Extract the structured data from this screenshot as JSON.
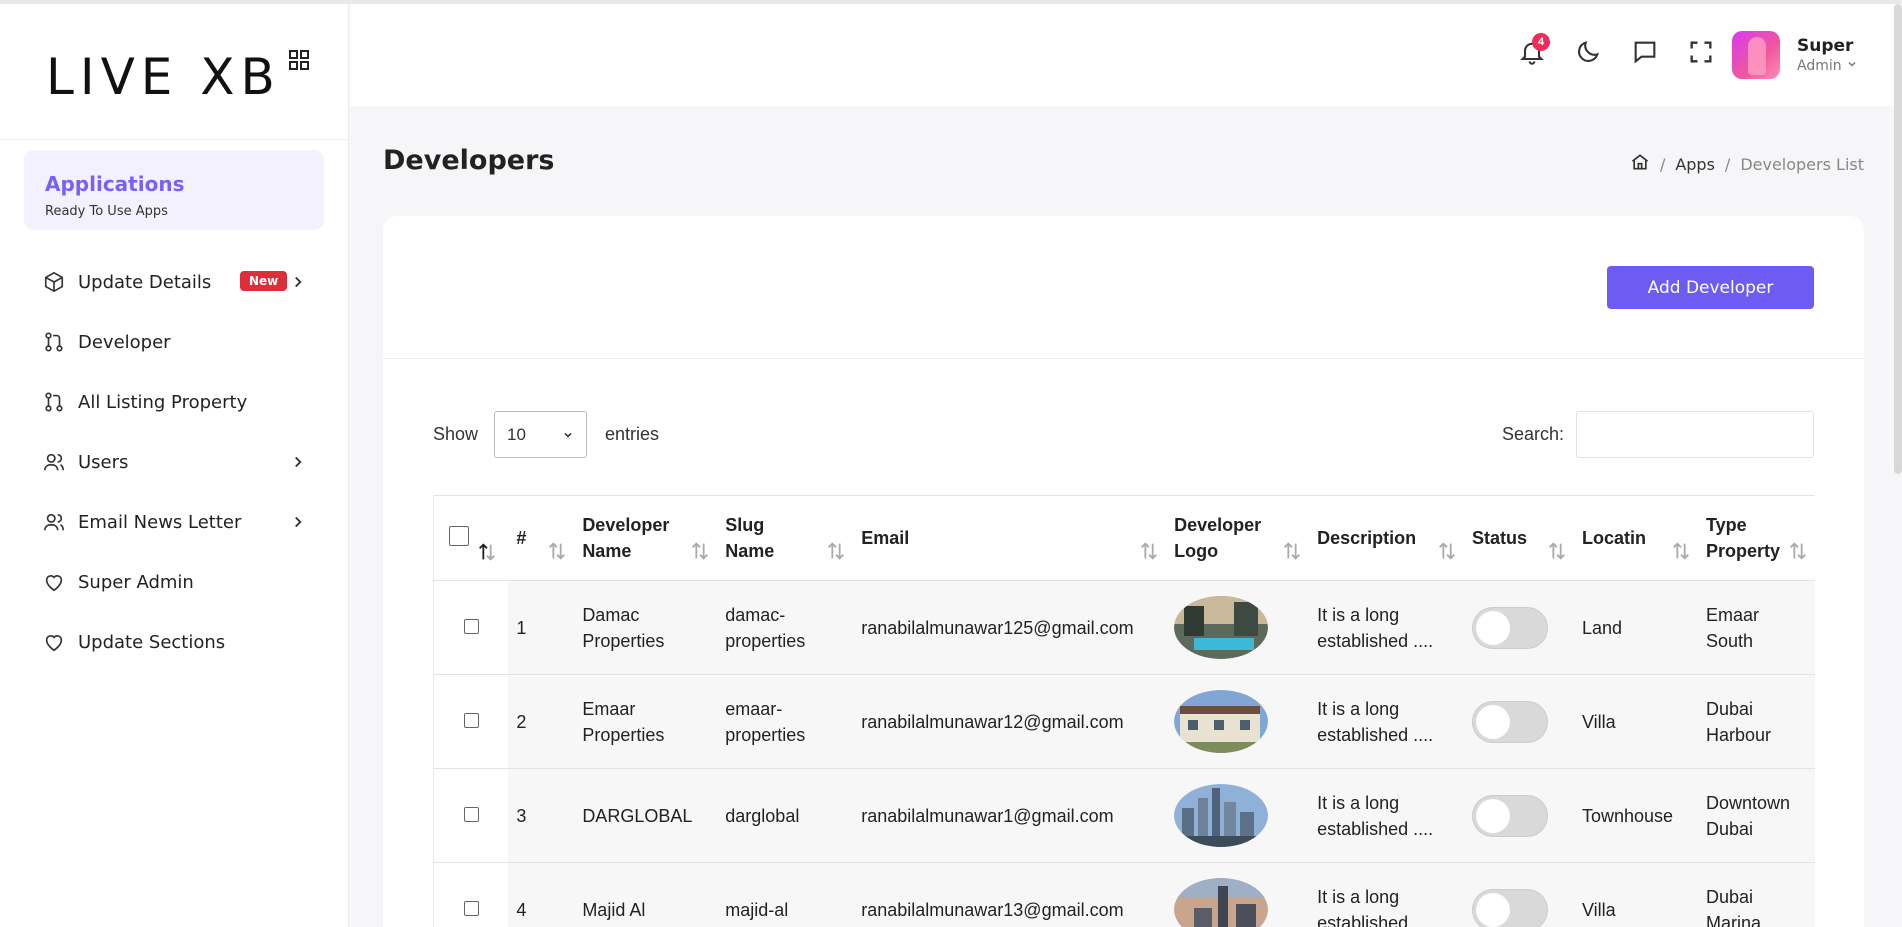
{
  "brand": {
    "logo_text": "LIVE XB"
  },
  "sidebar": {
    "app_card": {
      "title": "Applications",
      "subtitle": "Ready To Use Apps"
    },
    "items": [
      {
        "label": "Update Details",
        "badge": "New",
        "icon": "cube-icon",
        "has_chevron": true
      },
      {
        "label": "Developer",
        "icon": "git-pull-icon",
        "has_chevron": false
      },
      {
        "label": "All Listing Property",
        "icon": "git-pull-icon",
        "has_chevron": false
      },
      {
        "label": "Users",
        "icon": "users-icon",
        "has_chevron": true
      },
      {
        "label": "Email News Letter",
        "icon": "users-icon",
        "has_chevron": true
      },
      {
        "label": "Super Admin",
        "icon": "heart-icon",
        "has_chevron": false
      },
      {
        "label": "Update Sections",
        "icon": "heart-icon",
        "has_chevron": false
      }
    ]
  },
  "header": {
    "notification_count": "4",
    "user_name": "Super",
    "user_role": "Admin"
  },
  "page": {
    "title": "Developers",
    "breadcrumb": {
      "level1": "Apps",
      "level2": "Developers List"
    }
  },
  "toolbar": {
    "add_label": "Add Developer",
    "show_label": "Show",
    "entries_value": "10",
    "entries_label": "entries",
    "search_label": "Search:",
    "search_value": ""
  },
  "table": {
    "columns": {
      "num": "#",
      "name": "Developer Name",
      "slug": "Slug Name",
      "email": "Email",
      "logo": "Developer Logo",
      "description": "Description",
      "status": "Status",
      "location": "Locatin",
      "type": "Type Property"
    },
    "rows": [
      {
        "num": "1",
        "name": "Damac Properties",
        "slug": "damac-properties",
        "email": "ranabilalmunawar125@gmail.com",
        "description": "It is a long established ....",
        "status": false,
        "location": "Land",
        "type": "Emaar South"
      },
      {
        "num": "2",
        "name": "Emaar Properties",
        "slug": "emaar-properties",
        "email": "ranabilalmunawar12@gmail.com",
        "description": "It is a long established ....",
        "status": false,
        "location": "Villa",
        "type": "Dubai Harbour"
      },
      {
        "num": "3",
        "name": "DARGLOBAL",
        "slug": "darglobal",
        "email": "ranabilalmunawar1@gmail.com",
        "description": "It is a long established ....",
        "status": false,
        "location": "Townhouse",
        "type": "Downtown Dubai"
      },
      {
        "num": "4",
        "name": "Majid Al",
        "slug": "majid-al",
        "email": "ranabilalmunawar13@gmail.com",
        "description": "It is a long established ....",
        "status": false,
        "location": "Villa",
        "type": "Dubai Marina"
      }
    ]
  },
  "colors": {
    "accent": "#6c5cf2",
    "badge_red": "#dc2f3a",
    "notif_pink": "#ef2c5a"
  }
}
